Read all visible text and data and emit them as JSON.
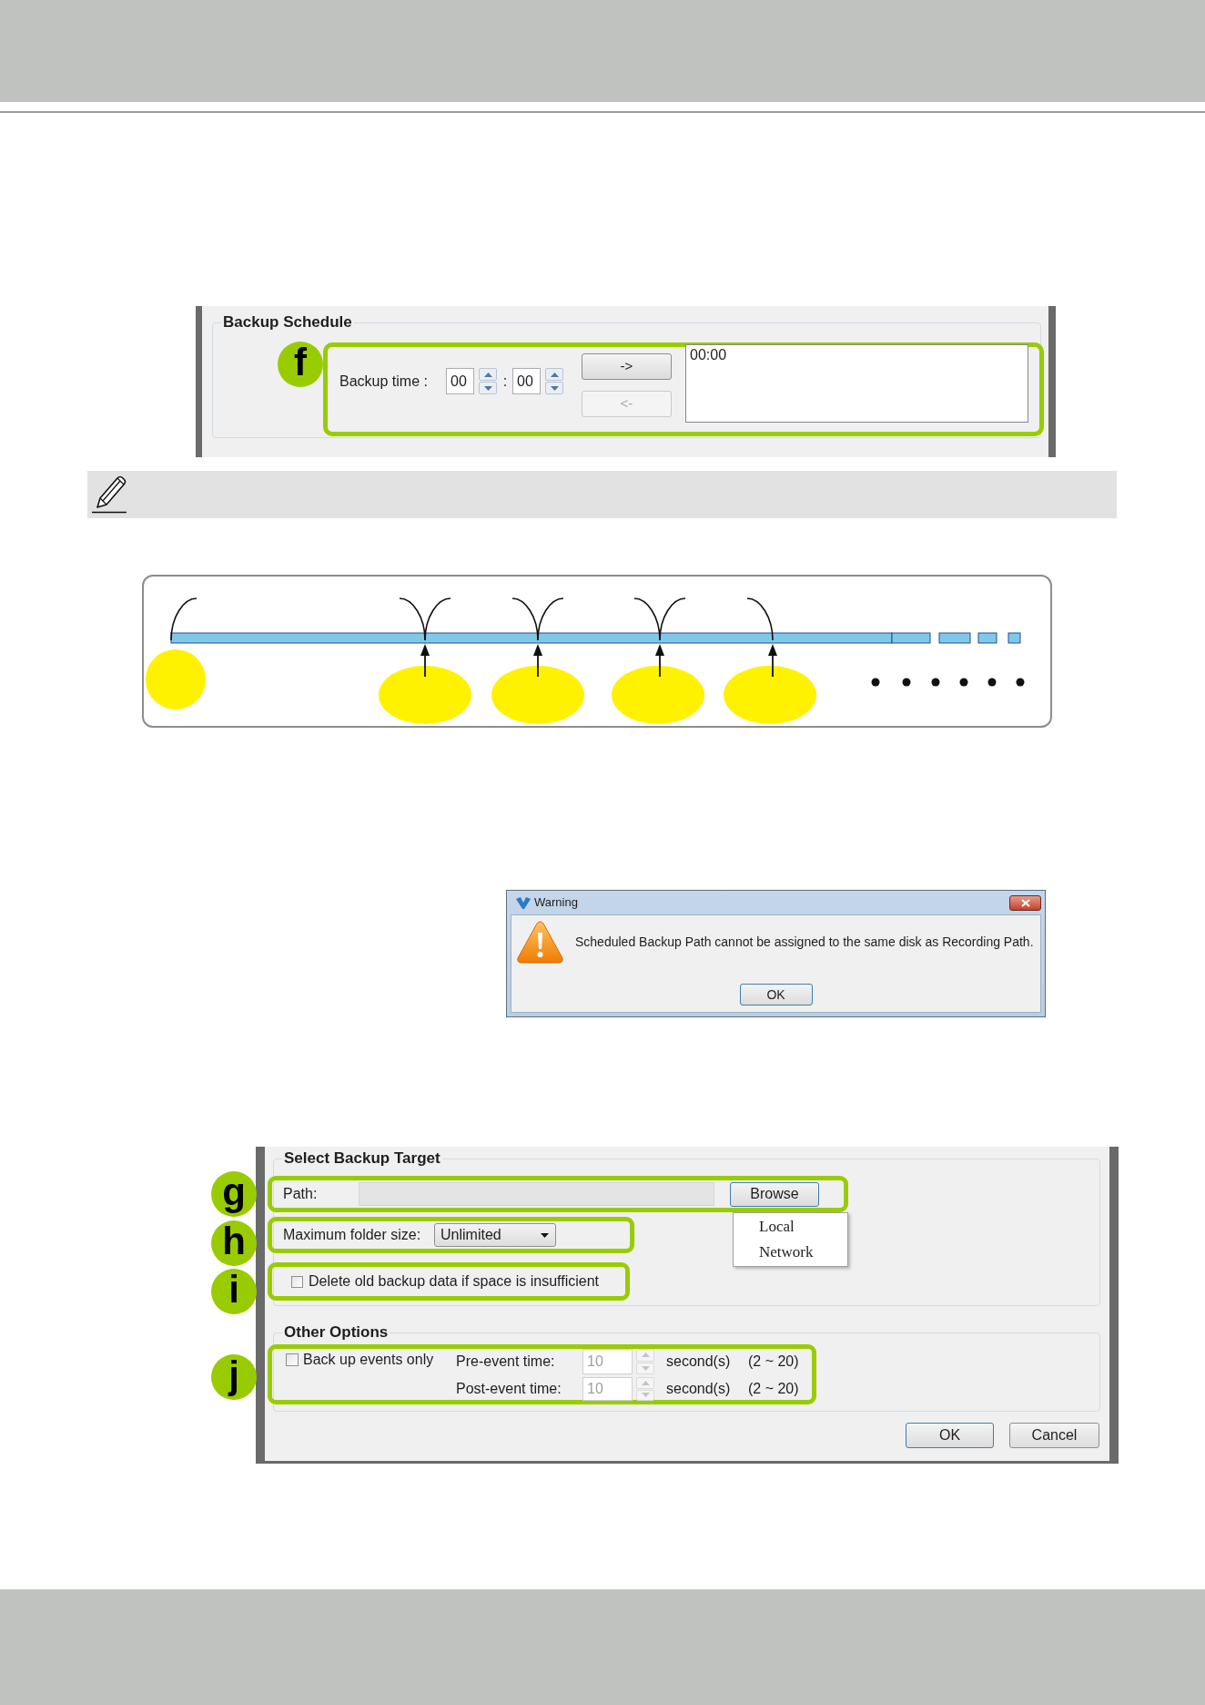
{
  "backup_schedule": {
    "title": "Backup Schedule",
    "callout": "f",
    "time_label": "Backup time :",
    "hour": "00",
    "separator": ":",
    "minute": "00",
    "buttons": [
      {
        "label": "->",
        "disabled": false
      },
      {
        "label": "<-",
        "disabled": true
      }
    ],
    "scheduled_times": [
      "00:00"
    ]
  },
  "warning_dialog": {
    "title": "Warning",
    "message": "Scheduled Backup Path cannot be assigned to the same disk as Recording Path.",
    "button": {
      "label": "OK",
      "focused": true
    }
  },
  "backup_target": {
    "title": "Select Backup Target",
    "path": {
      "callout": "g",
      "label": "Path:",
      "button": {
        "label": "Browse",
        "focused": true
      },
      "menu": [
        "Local",
        "Network"
      ]
    },
    "folder_size": {
      "callout": "h",
      "label": "Maximum folder size:",
      "value": "Unlimited"
    },
    "delete_old": {
      "callout": "i",
      "label": "Delete old backup data if space is insufficient",
      "checked": false
    },
    "other_options": {
      "title": "Other Options",
      "callout": "j",
      "events_only": {
        "label": "Back up events only",
        "checked": false
      },
      "event_times": [
        {
          "label": "Pre-event time:",
          "value": "10",
          "unit": "second(s)",
          "range": "(2 ~ 20)",
          "disabled": true
        },
        {
          "label": "Post-event time:",
          "value": "10",
          "unit": "second(s)",
          "range": "(2 ~ 20)",
          "disabled": true
        }
      ]
    },
    "buttons": [
      {
        "label": "OK",
        "focused": true
      },
      {
        "label": "Cancel",
        "focused": false
      }
    ]
  }
}
